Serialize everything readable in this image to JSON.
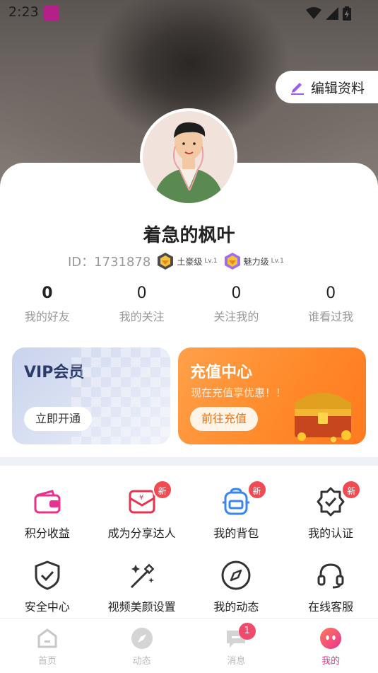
{
  "status": {
    "time": "2:23"
  },
  "header": {
    "edit_label": "编辑资料"
  },
  "profile": {
    "name": "着急的枫叶",
    "id_text": "ID：1731878",
    "levels": [
      {
        "name": "土豪级",
        "lv": "Lv.1"
      },
      {
        "name": "魅力级",
        "lv": "Lv.1"
      }
    ]
  },
  "stats": [
    {
      "value": "0",
      "label": "我的好友"
    },
    {
      "value": "0",
      "label": "我的关注"
    },
    {
      "value": "0",
      "label": "关注我的"
    },
    {
      "value": "0",
      "label": "谁看过我"
    }
  ],
  "promos": {
    "vip": {
      "title": "VIP会员",
      "button": "立即开通"
    },
    "recharge": {
      "title": "充值中心",
      "subtitle": "现在充值享优惠！！",
      "button": "前往充值"
    }
  },
  "menu": [
    {
      "label": "积分收益",
      "badge": ""
    },
    {
      "label": "成为分享达人",
      "badge": "新"
    },
    {
      "label": "我的背包",
      "badge": "新"
    },
    {
      "label": "我的认证",
      "badge": "新"
    },
    {
      "label": "安全中心",
      "badge": ""
    },
    {
      "label": "视频美颜设置",
      "badge": ""
    },
    {
      "label": "我的动态",
      "badge": ""
    },
    {
      "label": "在线客服",
      "badge": ""
    }
  ],
  "tabs": [
    {
      "label": "首页"
    },
    {
      "label": "动态"
    },
    {
      "label": "消息",
      "badge": "1"
    },
    {
      "label": "我的"
    }
  ],
  "colors": {
    "accent": "#e8338e",
    "badge": "#f04a52",
    "recharge": "#ff8a2a"
  }
}
